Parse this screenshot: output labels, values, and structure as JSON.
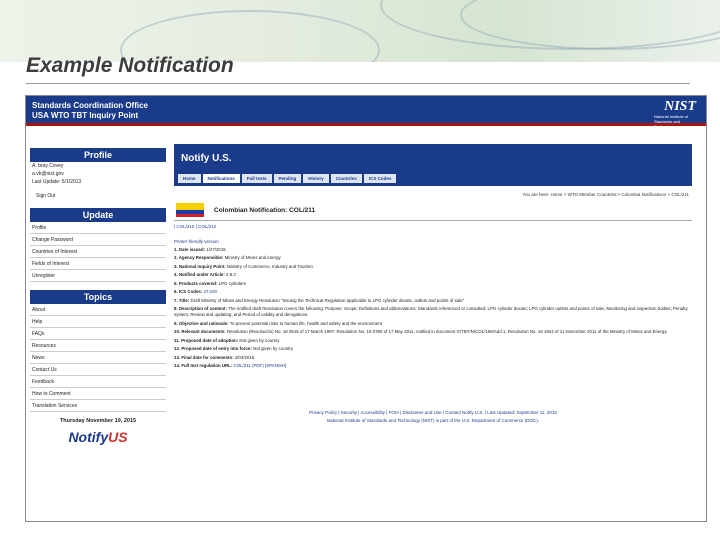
{
  "slide": {
    "title": "Example Notification"
  },
  "header": {
    "line1": "Standards Coordination Office",
    "line2": "USA WTO TBT Inquiry Point",
    "logo": "NIST",
    "logo_sub": "National Institute of Standards and Technology"
  },
  "sidebar": {
    "profile": {
      "title": "Profile",
      "name": "A. bray Covey",
      "email": "a.vb@nist.gov",
      "last_update": "Last Update: 5/1/2013",
      "sign_out": "Sign Out"
    },
    "update": {
      "title": "Update",
      "items": [
        "Profile",
        "Change Password",
        "Countries of Interest",
        "Fields of Interest",
        "Unregister"
      ]
    },
    "topics": {
      "title": "Topics",
      "items": [
        "About",
        "Help",
        "FAQs",
        "Resources",
        "News",
        "Contact Us",
        "Feedback",
        "How to Comment",
        "Translation Services"
      ]
    },
    "date": "Thursday November 19, 2015",
    "logo_a": "Notify",
    "logo_b": "US"
  },
  "main": {
    "title": "Notify U.S.",
    "tabs": [
      "Home",
      "Notifications",
      "Full texts",
      "Pending",
      "History",
      "Countries",
      "ICS Codes"
    ],
    "breadcrumb": "You are here: Home > WTO Member Countries > Colombia Notifications > COL/211",
    "country_title": "Colombian Notification: COL/211",
    "nav": "| COL/210 | COL/212",
    "printer": "Printer friendly version",
    "fields": [
      {
        "label": "1. Date issued:",
        "value": " 1/27/2015"
      },
      {
        "label": "2. Agency Responsible:",
        "value": " Ministry of Mines and energy"
      },
      {
        "label": "3. National Inquiry Point:",
        "value": " Ministry of Commerce, Industry and Tourism"
      },
      {
        "label": "4. Notified under Article:",
        "value": " 2.9.2"
      },
      {
        "label": "5. Products covered:",
        "value": " LPG cylinders"
      },
      {
        "label": "6. ICS Codes:",
        "value": " 27.020"
      },
      {
        "label": "7. Title:",
        "value": " Draft Ministry of Mines and Energy Resolution \"Issuing the Technical Regulation applicable to LPG cylinder decals, outlets and points of sale\""
      },
      {
        "label": "8. Description of content:",
        "value": " The notified draft Resolution covers the following: Purpose; Scope; Definitions and abbreviations; Standards referenced or consulted; LPG cylinder decals; LPG cylinder outlets and points of sale; Monitoring and inspection bodies; Penalty system; Review and updating; and Period of validity and derogations."
      },
      {
        "label": "9. Objective and rationale:",
        "value": " To prevent potential risks to human life, health and safety and the environment"
      },
      {
        "label": "10. Relevant documents:",
        "value": " Resolution (Resolución) No. 18 0515 of 17 March 1997; Resolution No. 18 0780 of 17 May 2011, notified in document G/TBT/N/COL/156/Add.1; Resolution No. 18 1924 of 11 November 2011 of the Ministry of Mines and Energy."
      },
      {
        "label": "11. Proposed date of adoption:",
        "value": " Not given by country"
      },
      {
        "label": "12. Proposed date of entry into force:",
        "value": " Not given by country"
      },
      {
        "label": "13. Final date for comments:",
        "value": " 4/03/2015"
      },
      {
        "label": "14. Full text regulation URL:",
        "value": " COL/211 (PDF) [SPANISH]"
      }
    ],
    "footer_line1": "Privacy Policy | Security | Accessibility | FOIA | Disclaimer and Use | Contact Notify U.S. | Last Updated: September 11, 2015",
    "footer_line2": "National Institute of Standards and Technology (NIST) is part of the U.S. Department of Commerce (DOC)."
  },
  "colors": {
    "navy": "#1a3a8a",
    "accent": "#a11",
    "flag_yellow": "#f5d000",
    "flag_blue": "#1d3ba8",
    "flag_red": "#d2202f"
  }
}
